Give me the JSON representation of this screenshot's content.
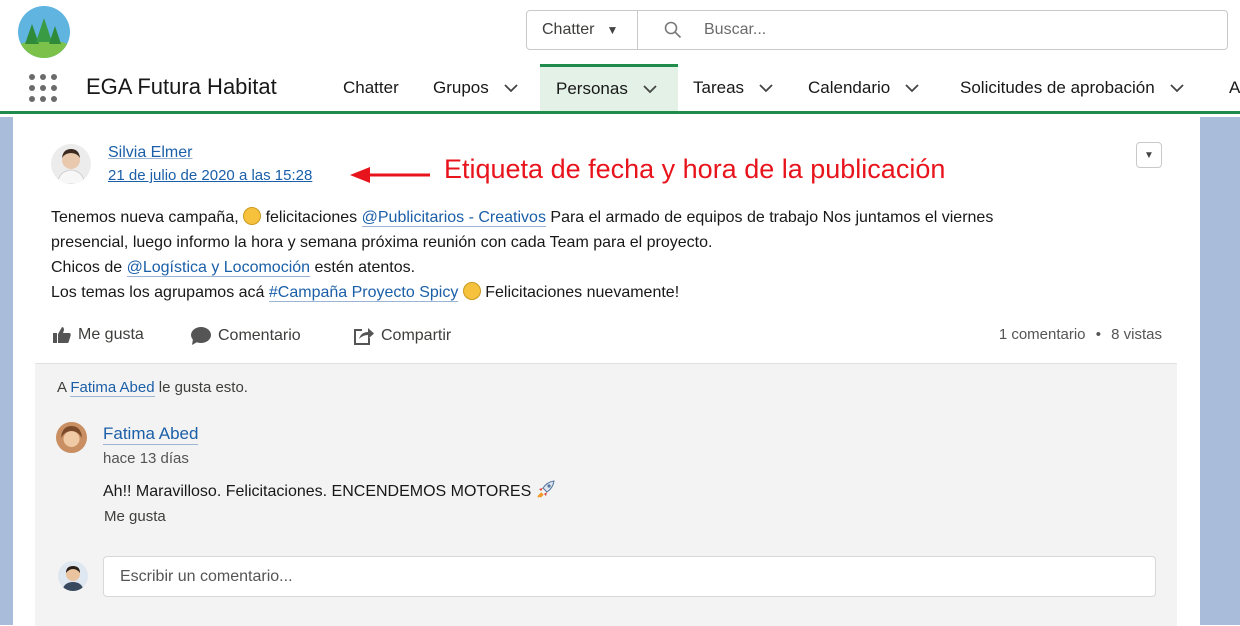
{
  "header": {
    "search_scope": "Chatter",
    "search_placeholder": "Buscar..."
  },
  "nav": {
    "app_name": "EGA Futura Habitat",
    "tabs": [
      {
        "label": "Chatter"
      },
      {
        "label": "Grupos"
      },
      {
        "label": "Personas"
      },
      {
        "label": "Tareas"
      },
      {
        "label": "Calendario"
      },
      {
        "label": "Solicitudes de aprobación"
      },
      {
        "label": "A"
      }
    ]
  },
  "post": {
    "author": "Silvia Elmer",
    "timestamp": "21 de julio de 2020 a las 15:28",
    "annotation": "Etiqueta de fecha y hora de la publicación",
    "line1_a": "Tenemos nueva campaña,",
    "line1_b": "felicitaciones",
    "mention1": "@Publicitarios - Creativos",
    "line1_c": "Para el armado de equipos de trabajo Nos juntamos el viernes",
    "line2": "presencial, luego informo la hora y semana próxima reunión con cada Team para el proyecto.",
    "line3_a": "Chicos de",
    "mention2": "@Logística y Locomoción",
    "line3_b": "estén atentos.",
    "line4_a": "Los temas los agrupamos acá",
    "hashtag": "#Campaña Proyecto Spicy",
    "line4_b": "Felicitaciones nuevamente!"
  },
  "actions": {
    "like": "Me gusta",
    "comment": "Comentario",
    "share": "Compartir",
    "comment_count": "1 comentario",
    "separator": "•",
    "views": "8 vistas"
  },
  "likes": {
    "prefix": "A",
    "user": "Fatima Abed",
    "suffix": "le gusta esto."
  },
  "comment": {
    "author": "Fatima Abed",
    "time": "hace 13 días",
    "text": "Ah!! Maravilloso. Felicitaciones. ENCENDEMOS MOTORES",
    "like": "Me gusta"
  },
  "composer": {
    "placeholder": "Escribir un comentario..."
  },
  "colors": {
    "accent_green": "#1f8c4b",
    "link_blue": "#1b5fa8",
    "annotation_red": "#e8141c",
    "side_blue": "#a9bcd9"
  }
}
